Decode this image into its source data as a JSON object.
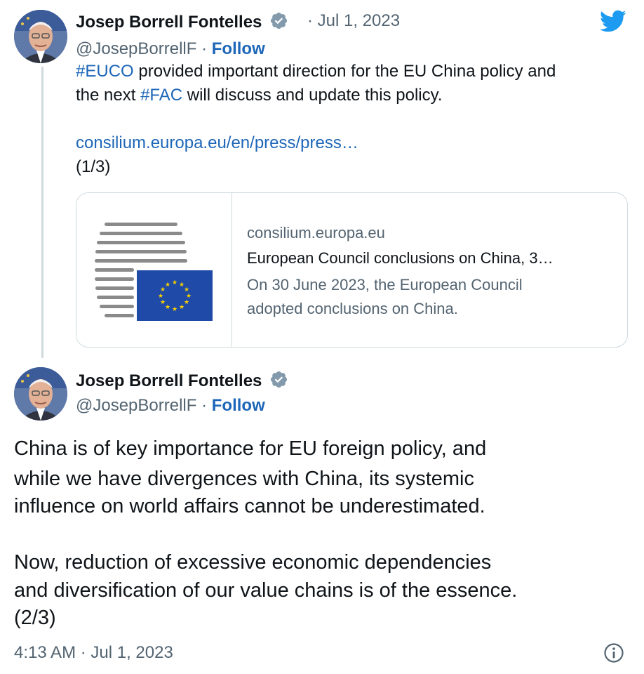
{
  "tweet1": {
    "author_name": "Josep Borrell Fontelles",
    "separator": "·",
    "date": "Jul 1, 2023",
    "handle": "@JosepBorrellF",
    "follow_sep": "·",
    "follow_label": "Follow",
    "line1_hashtag": "#EUCO",
    "line1_rest": " provided important direction for the EU China policy and",
    "line2_pre": "the next ",
    "line2_hashtag": "#FAC",
    "line2_rest": " will discuss and update this policy.",
    "link": "consilium.europa.eu/en/press/press…",
    "counter": "(1/3)",
    "card": {
      "domain": "consilium.europa.eu",
      "title": "European Council conclusions on China, 3…",
      "desc_line1": "On 30 June 2023, the European Council",
      "desc_line2": "adopted conclusions on China."
    }
  },
  "tweet2": {
    "author_name": "Josep Borrell Fontelles",
    "handle": "@JosepBorrellF",
    "follow_sep": "·",
    "follow_label": "Follow",
    "body_lines": [
      "China is of key importance for EU foreign policy, and",
      "while we have divergences with China, its systemic",
      "influence on world affairs cannot be underestimated.",
      "",
      "Now, reduction of excessive  economic dependencies",
      "and diversification of our  value chains is of the essence.",
      "(2/3)"
    ],
    "timestamp": "4:13 AM · Jul 1, 2023"
  },
  "icons": {
    "brand": "twitter-bird-icon",
    "verified": "verified-badge-icon",
    "info": "info-icon"
  },
  "colors": {
    "link": "#1d66b8",
    "twitter_blue": "#1d9bf0",
    "secondary_text": "#536471",
    "border": "#cfd9de",
    "eu_blue": "#1f4aa8",
    "eu_star": "#f6d000"
  }
}
